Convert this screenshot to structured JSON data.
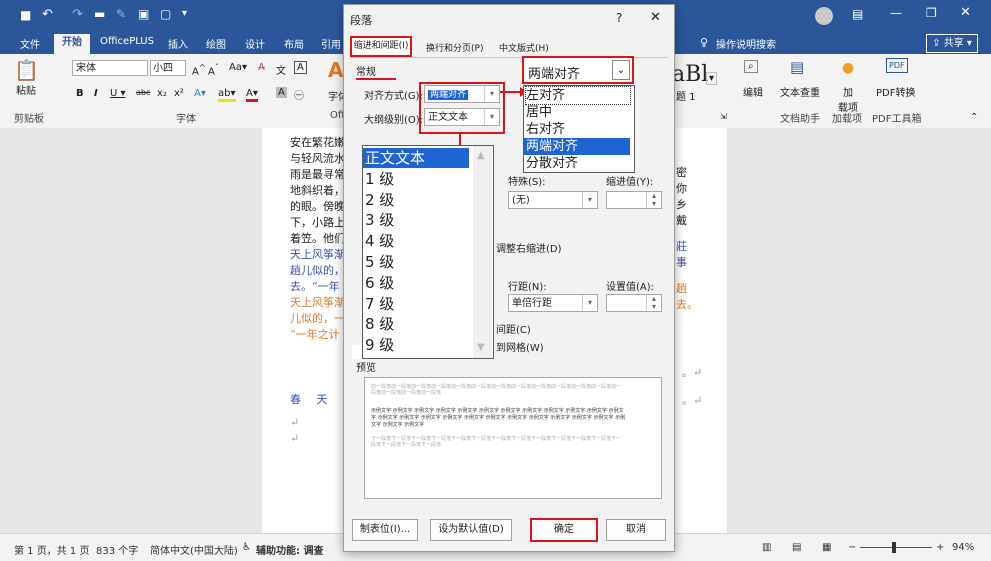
{
  "word": {
    "ribbon_tabs": [
      "文件",
      "开始",
      "OfficePLUS",
      "插入",
      "绘图",
      "设计",
      "布局",
      "引用"
    ],
    "active_tab": "开始",
    "tell_me": "操作说明搜索",
    "share": "共享",
    "paste": "粘贴",
    "clipboard": "剪贴板",
    "font_name": "宋体",
    "font_size": "小四",
    "font_group": "字体",
    "styles_preview": "aBl",
    "styles_sub": "题 1",
    "edit": "编辑",
    "word_check": "文本查重",
    "word_assist": "文档助手",
    "addins": "加\n载项",
    "addins_group": "加载项",
    "pdf_convert": "PDF转换",
    "pdf_tools": "PDF工具箱",
    "char_label": "字体",
    "off_label": "Off"
  },
  "document": {
    "lines": [
      {
        "text": "安在繁花嫩",
        "cls": ""
      },
      {
        "text": "与轻风流水",
        "cls": ""
      },
      {
        "text": "雨是最寻常",
        "cls": ""
      },
      {
        "text": "地斜织着，",
        "cls": ""
      },
      {
        "text": "的眼。傍晚",
        "cls": ""
      },
      {
        "text": "下，小路上",
        "cls": ""
      },
      {
        "text": "着笠。他们",
        "cls": ""
      },
      {
        "text": "天上风筝渐",
        "cls": "blue"
      },
      {
        "text": "趟儿似的，",
        "cls": "blue"
      },
      {
        "text": "去。“一年",
        "cls": "blue"
      },
      {
        "text": "天上风筝渐",
        "cls": "orange"
      },
      {
        "text": "儿似的，一",
        "cls": "orange"
      },
      {
        "text": "“一年之计",
        "cls": "orange"
      }
    ],
    "right_lines": [
      {
        "text": "密",
        "cls": ""
      },
      {
        "text": "你",
        "cls": ""
      },
      {
        "text": "乡",
        "cls": ""
      },
      {
        "text": "戴",
        "cls": ""
      },
      {
        "text": "莊",
        "cls": "blue"
      },
      {
        "text": "事",
        "cls": "blue"
      },
      {
        "text": "趟",
        "cls": "orange"
      },
      {
        "text": "去。",
        "cls": "orange"
      }
    ],
    "spring_line": "春 天 像"
  },
  "status": {
    "page": "第 1 页，共 1 页",
    "words": "833 个字",
    "language": "简体中文(中国大陆)",
    "accessibility": "辅助功能: 调查",
    "zoom": "94%"
  },
  "dialog": {
    "title": "段落",
    "help": "?",
    "close": "✕",
    "tabs": [
      "缩进和间距(I)",
      "换行和分页(P)",
      "中文版式(H)"
    ],
    "general": "常规",
    "alignment_label": "对齐方式(G):",
    "alignment_value": "两端对齐",
    "outline_label": "大纲级别(O):",
    "outline_value": "正文文本",
    "special_label": "特殊(S):",
    "indent_value_label": "缩进值(Y):",
    "special_value": "(无)",
    "auto_adjust": "调整右缩进(D)",
    "line_spacing_label": "行距(N):",
    "set_value_label": "设置值(A):",
    "line_spacing_value": "单倍行距",
    "spacing_check": "间距(C)",
    "grid_check": "到网格(W)",
    "preview_label": "预览",
    "preview_prev": "前一段落前一段落前一段落前一段落前一段落前一段落前一段落前一段落前一段落前一段落前一段落前一段落前一段落前一段落前一段落前一段落",
    "preview_sample": "示例文字 示例文字 示例文字 示例文字 示例文字 示例文字 示例文字 示例文字 示例文字 示例文字 示例文字 示例文字 示例文字 示例文字 示例文字 示例文字 示例文字 示例文字 示例文字 示例文字 示例文字 示例文字 示例文字 示例文字 示例文字 示例文字",
    "preview_next": "下一段落下一段落下一段落下一段落下一段落下一段落下一段落下一段落下一段落下一段落下一段落下一段落下一段落下一段落下一段落下一段落",
    "tabs_button": "制表位(I)...",
    "default_button": "设为默认值(D)",
    "ok_button": "确定",
    "cancel_button": "取消",
    "outline_levels": [
      "正文文本",
      "1 级",
      "2 级",
      "3 级",
      "4 级",
      "5 级",
      "6 级",
      "7 级",
      "8 级",
      "9 级"
    ],
    "align_options_header": "两端对齐",
    "align_options": [
      "左对齐",
      "居中",
      "右对齐",
      "两端对齐",
      "分散对齐"
    ]
  }
}
